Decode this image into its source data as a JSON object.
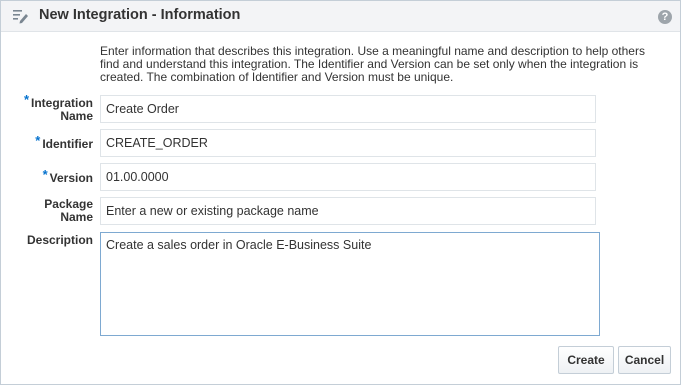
{
  "dialog": {
    "title": "New Integration - Information",
    "help_glyph": "?",
    "icon": "edit-form-icon"
  },
  "instructions": "Enter information that describes this integration. Use a meaningful name and description to help others find and understand this integration. The Identifier and Version can be set only when the integration is created. The combination of Identifier and Version must be unique.",
  "required_marker": "*",
  "fields": {
    "integration_name": {
      "label_line1": "Integration",
      "label_line2": "Name",
      "value": "Create Order",
      "required": true
    },
    "identifier": {
      "label": "Identifier",
      "value": "CREATE_ORDER",
      "required": true
    },
    "version": {
      "label": "Version",
      "value": "01.00.0000",
      "required": true
    },
    "package_name": {
      "label_line1": "Package",
      "label_line2": "Name",
      "value": "",
      "placeholder": "Enter a new or existing package name",
      "required": false
    },
    "description": {
      "label": "Description",
      "value": "Create a sales order in Oracle E-Business Suite",
      "required": false
    }
  },
  "buttons": {
    "create": "Create",
    "cancel": "Cancel"
  },
  "colors": {
    "required_star": "#0572ce",
    "titlebar_bg": "#f3f4f6",
    "focus_border": "#7ea9d1"
  }
}
